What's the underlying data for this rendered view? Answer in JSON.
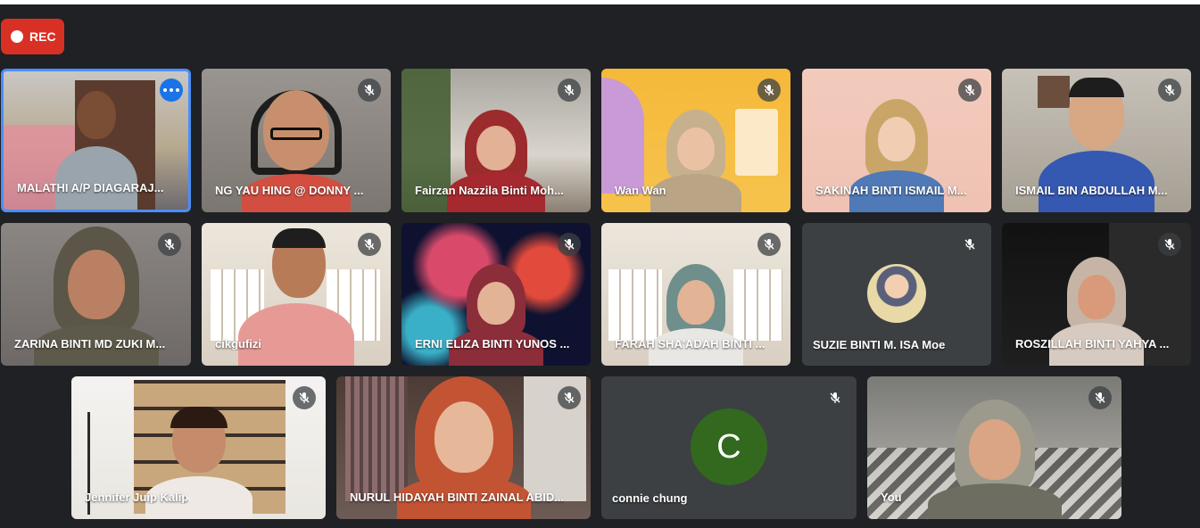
{
  "recording": {
    "label": "REC"
  },
  "participants": [
    {
      "name": "MALATHI A/P DIAGARAJ..."
    },
    {
      "name": "NG YAU HING @ DONNY ..."
    },
    {
      "name": "Fairzan Nazzila Binti Moh..."
    },
    {
      "name": "Wan Wan"
    },
    {
      "name": "SAKINAH BINTI ISMAIL M..."
    },
    {
      "name": "ISMAIL BIN ABDULLAH M..."
    },
    {
      "name": "ZARINA BINTI MD ZUKI M..."
    },
    {
      "name": "cikgufizi"
    },
    {
      "name": "ERNI ELIZA BINTI YUNOS ..."
    },
    {
      "name": "FARAH SHA'ADAH BINTI ..."
    },
    {
      "name": "SUZIE BINTI M. ISA Moe"
    },
    {
      "name": "ROSZILLAH BINTI YAHYA ..."
    },
    {
      "name": "Jennifer Juip Kalip"
    },
    {
      "name": "NURUL HIDAYAH BINTI ZAINAL ABID..."
    },
    {
      "name": "connie chung",
      "initial": "C"
    },
    {
      "name": "You"
    }
  ],
  "colors": {
    "accent": "#1a73e8",
    "record": "#d93025",
    "background": "#202124"
  }
}
